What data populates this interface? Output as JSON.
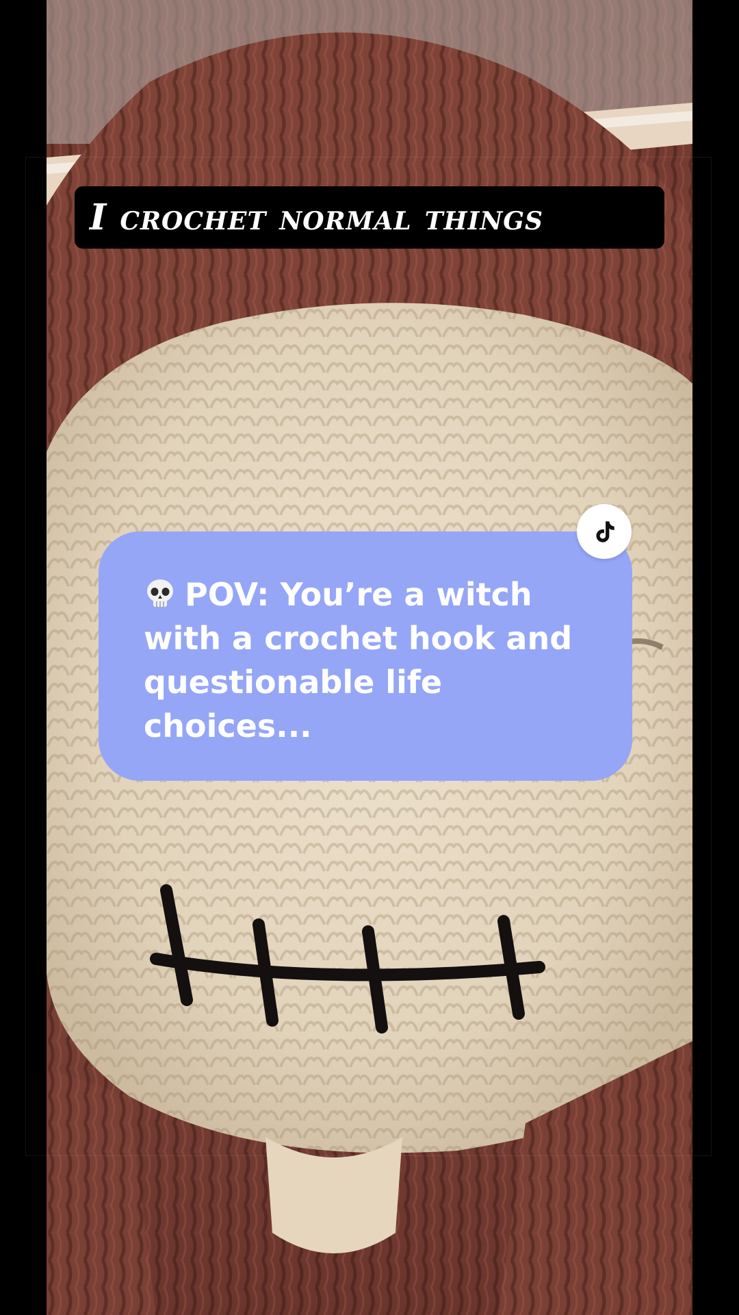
{
  "caption": {
    "text": "I crochet normal things"
  },
  "qa_card": {
    "emoji": "skull-icon",
    "text": "POV: You’re a witch with a crochet hook and questionable life choices..."
  },
  "badge": {
    "icon": "tiktok-logo-icon"
  },
  "colors": {
    "card_background": "#95a6f7",
    "caption_background": "#000000",
    "hair_yarn": "#7a3f35",
    "face_yarn": "#e9dcc6",
    "stitch_mouth": "#141010"
  }
}
